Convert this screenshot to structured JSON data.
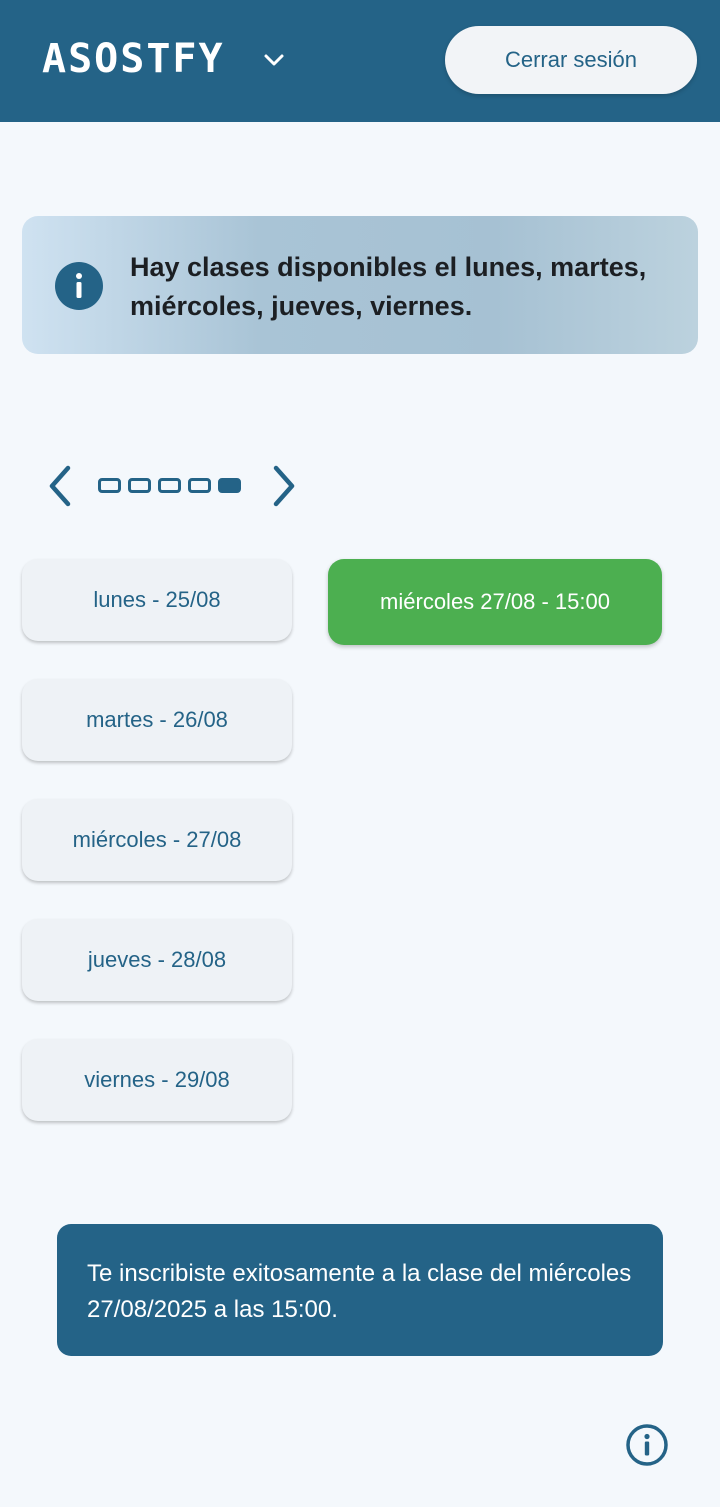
{
  "header": {
    "logo_text": "ASOSTFY",
    "logout_label": "Cerrar sesión",
    "icons": {
      "dropdown": "chevron-down-icon"
    }
  },
  "info_banner": {
    "text": "Hay clases disponibles el lunes, martes, miércoles, jueves, viernes.",
    "icon": "info-icon"
  },
  "pager": {
    "pages": 5,
    "active_page": 5,
    "icons": {
      "prev": "chevron-left-icon",
      "next": "chevron-right-icon"
    }
  },
  "days": [
    {
      "label": "lunes - 25/08"
    },
    {
      "label": "martes - 26/08"
    },
    {
      "label": "miércoles - 27/08"
    },
    {
      "label": "jueves - 28/08"
    },
    {
      "label": "viernes - 29/08"
    }
  ],
  "selected_slot": {
    "label": "miércoles 27/08 - 15:00"
  },
  "snackbar": {
    "text": "Te inscribiste exitosamente a la clase del miércoles 27/08/2025 a las 15:00."
  },
  "footer": {
    "help_icon": "info-outline-icon"
  },
  "colors": {
    "primary": "#246387",
    "success": "#4caf50",
    "background": "#f4f8fc",
    "button_bg": "#eef2f6"
  }
}
